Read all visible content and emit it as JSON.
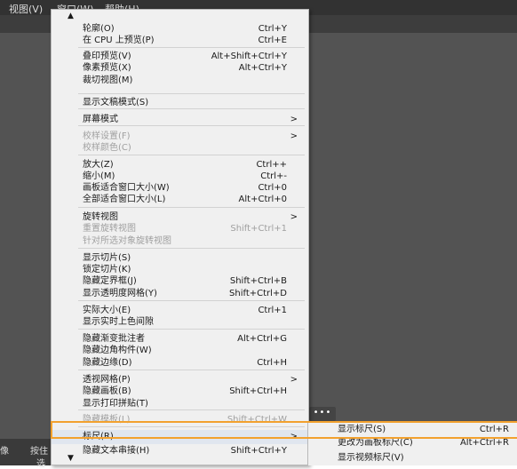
{
  "menubar": {
    "view": "视图(V)",
    "window": "窗口(W)",
    "help": "帮助(H)"
  },
  "statusbar": {
    "left1": "像",
    "left2": "按住",
    "left3": "选"
  },
  "more_label": "•••",
  "menu": {
    "scroll_up": "▲",
    "scroll_down": "▼",
    "items": [
      {
        "label": "轮廓(O)",
        "shortcut": "Ctrl+Y"
      },
      {
        "label": "在 CPU 上预览(P)",
        "shortcut": "Ctrl+E"
      },
      {
        "label": "叠印预览(V)",
        "shortcut": "Alt+Shift+Ctrl+Y"
      },
      {
        "label": "像素预览(X)",
        "shortcut": "Alt+Ctrl+Y"
      },
      {
        "label": "裁切视图(M)",
        "shortcut": ""
      },
      {
        "label": "显示文稿模式(S)",
        "shortcut": ""
      },
      {
        "label": "屏幕模式",
        "shortcut": "",
        "submenu": true
      },
      {
        "label": "校样设置(F)",
        "shortcut": "",
        "submenu": true,
        "disabled": true
      },
      {
        "label": "校样颜色(C)",
        "shortcut": "",
        "disabled": true
      },
      {
        "label": "放大(Z)",
        "shortcut": "Ctrl++"
      },
      {
        "label": "缩小(M)",
        "shortcut": "Ctrl+-"
      },
      {
        "label": "画板适合窗口大小(W)",
        "shortcut": "Ctrl+0"
      },
      {
        "label": "全部适合窗口大小(L)",
        "shortcut": "Alt+Ctrl+0"
      },
      {
        "label": "旋转视图",
        "shortcut": "",
        "submenu": true
      },
      {
        "label": "重置旋转视图",
        "shortcut": "Shift+Ctrl+1",
        "disabled": true
      },
      {
        "label": "针对所选对象旋转视图",
        "shortcut": "",
        "disabled": true
      },
      {
        "label": "显示切片(S)",
        "shortcut": ""
      },
      {
        "label": "锁定切片(K)",
        "shortcut": ""
      },
      {
        "label": "隐藏定界框(J)",
        "shortcut": "Shift+Ctrl+B"
      },
      {
        "label": "显示透明度网格(Y)",
        "shortcut": "Shift+Ctrl+D"
      },
      {
        "label": "实际大小(E)",
        "shortcut": "Ctrl+1"
      },
      {
        "label": "显示实时上色间隙",
        "shortcut": ""
      },
      {
        "label": "隐藏渐变批注者",
        "shortcut": "Alt+Ctrl+G"
      },
      {
        "label": "隐藏边角构件(W)",
        "shortcut": ""
      },
      {
        "label": "隐藏边缘(D)",
        "shortcut": "Ctrl+H"
      },
      {
        "label": "透视网格(P)",
        "shortcut": "",
        "submenu": true
      },
      {
        "label": "隐藏画板(B)",
        "shortcut": "Shift+Ctrl+H"
      },
      {
        "label": "显示打印拼贴(T)",
        "shortcut": ""
      },
      {
        "label": "隐藏模板(L)",
        "shortcut": "Shift+Ctrl+W",
        "disabled": true
      },
      {
        "label": "标尺(R)",
        "shortcut": "",
        "submenu": true,
        "highlight": true
      },
      {
        "label": "隐藏文本串接(H)",
        "shortcut": "Shift+Ctrl+Y"
      }
    ]
  },
  "submenu": {
    "items": [
      {
        "label": "显示标尺(S)",
        "shortcut": "Ctrl+R"
      },
      {
        "label": "更改为画板标尺(C)",
        "shortcut": "Alt+Ctrl+R"
      },
      {
        "label": "显示视频标尺(V)",
        "shortcut": ""
      }
    ]
  },
  "submenu_arrow": ">"
}
